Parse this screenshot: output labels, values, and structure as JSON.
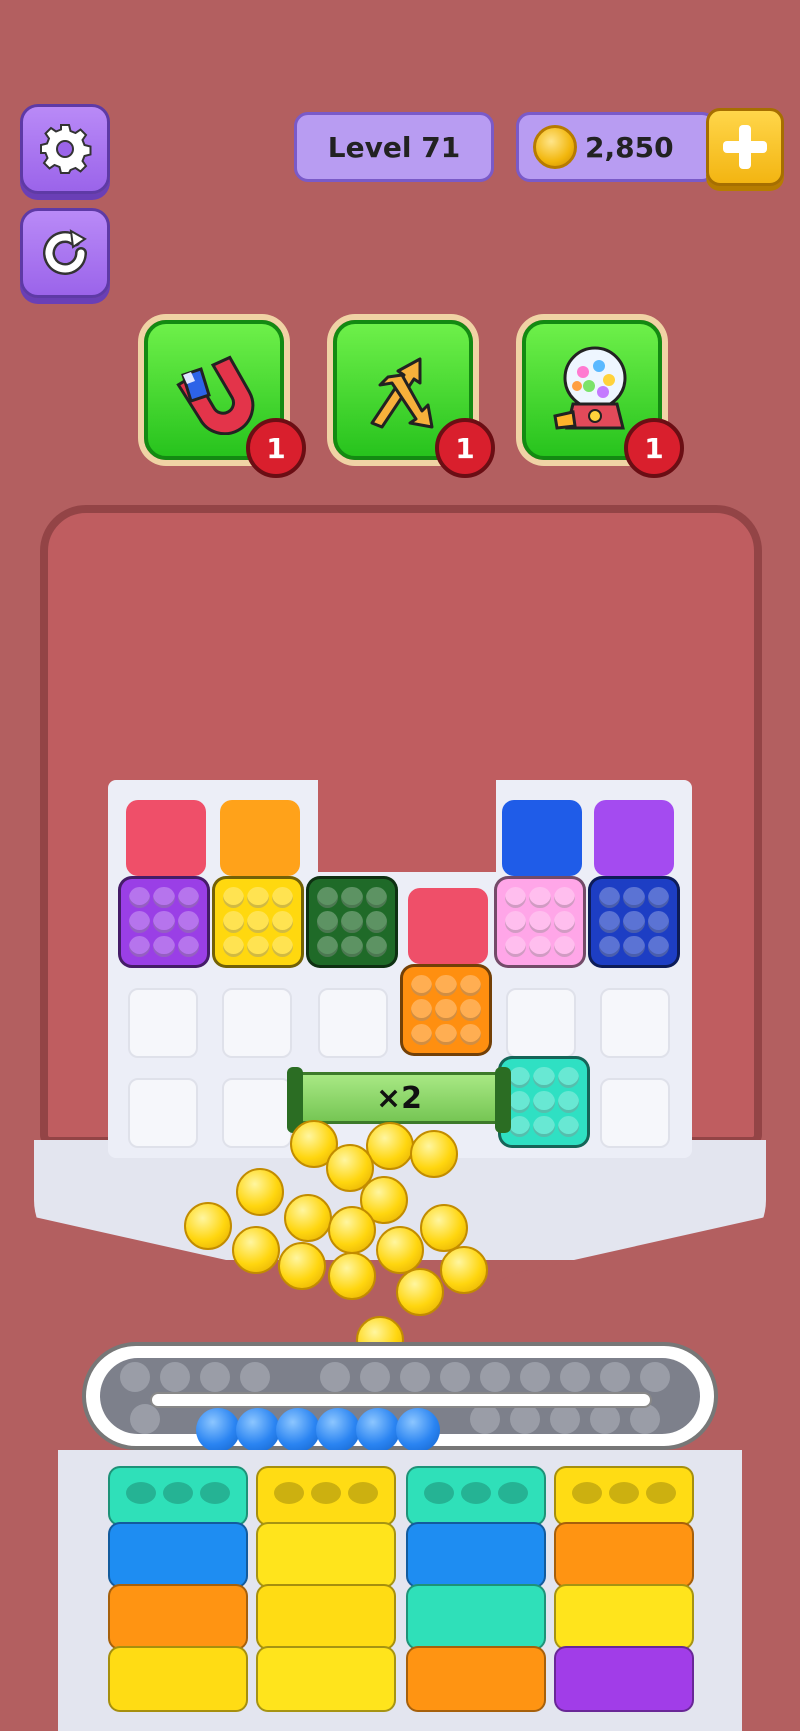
{
  "header": {
    "level_label": "Level 71",
    "coins": "2,850"
  },
  "icons": {
    "settings": "gear-icon",
    "restart": "restart-icon",
    "add_coins": "plus-icon"
  },
  "boosters": [
    {
      "name": "magnet",
      "count": "1"
    },
    {
      "name": "shuffle",
      "count": "1"
    },
    {
      "name": "gumball",
      "count": "1"
    }
  ],
  "multiplier": "×2",
  "colors": {
    "red": "#ef4f69",
    "orange": "#ff9a12",
    "yellow": "#ffd80f",
    "blue": "#1f5ce8",
    "purple": "#a13de8",
    "darkgreen": "#1f6a28",
    "pink": "#ff9fe5",
    "navy": "#1d3ec4",
    "teal": "#2fe0c3",
    "sky": "#1e8df2"
  }
}
